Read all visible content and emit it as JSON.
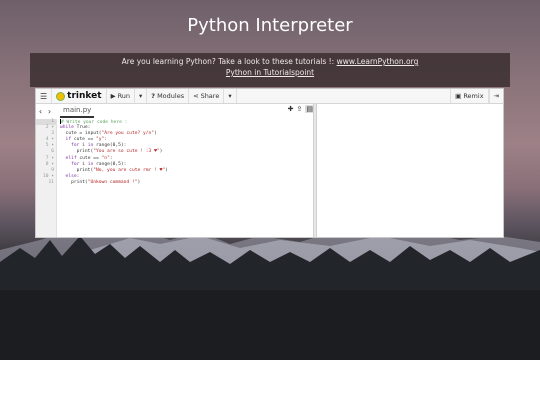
{
  "page": {
    "title": "Python Interpreter"
  },
  "banner": {
    "text": "Are you learning Python? Take a look to these tutorials !:",
    "link1": "www.LearnPython.org",
    "link2": "Python in Tutorialspoint"
  },
  "toolbar": {
    "menu_icon": "hamburger-icon",
    "logo_text": "trinket",
    "run_label": "Run",
    "modules_label": "Modules",
    "share_label": "Share",
    "remix_label": "Remix"
  },
  "editor": {
    "tab_label": "main.py",
    "line_numbers": [
      "1",
      "2 ▾",
      "3",
      "4 ▾",
      "5 ▾",
      "6",
      "7 ▾",
      "8 ▾",
      "9",
      "10 ▾",
      "11"
    ],
    "lines": [
      {
        "indent": "",
        "parts": [
          {
            "t": "# Write your code here :",
            "c": "cm"
          }
        ]
      },
      {
        "indent": "",
        "parts": [
          {
            "t": "while ",
            "c": "kw"
          },
          {
            "t": "True:",
            "c": ""
          }
        ]
      },
      {
        "indent": "  ",
        "parts": [
          {
            "t": "cute = input(",
            "c": ""
          },
          {
            "t": "\"Are you cute? y/n\"",
            "c": "st"
          },
          {
            "t": ")",
            "c": ""
          }
        ]
      },
      {
        "indent": "  ",
        "parts": [
          {
            "t": "if ",
            "c": "kw"
          },
          {
            "t": "cute == ",
            "c": ""
          },
          {
            "t": "\"y\"",
            "c": "st"
          },
          {
            "t": ":",
            "c": ""
          }
        ]
      },
      {
        "indent": "    ",
        "parts": [
          {
            "t": "for ",
            "c": "kw"
          },
          {
            "t": "i ",
            "c": ""
          },
          {
            "t": "in ",
            "c": "kw"
          },
          {
            "t": "range(0,5):",
            "c": ""
          }
        ]
      },
      {
        "indent": "      ",
        "parts": [
          {
            "t": "print(",
            "c": ""
          },
          {
            "t": "\"You are so cute ! :3 ♥\"",
            "c": "st"
          },
          {
            "t": ")",
            "c": ""
          }
        ]
      },
      {
        "indent": "  ",
        "parts": [
          {
            "t": "elif ",
            "c": "kw"
          },
          {
            "t": "cute == ",
            "c": ""
          },
          {
            "t": "\"n\"",
            "c": "st"
          },
          {
            "t": ":",
            "c": ""
          }
        ]
      },
      {
        "indent": "    ",
        "parts": [
          {
            "t": "for ",
            "c": "kw"
          },
          {
            "t": "i ",
            "c": ""
          },
          {
            "t": "in ",
            "c": "kw"
          },
          {
            "t": "range(0,5):",
            "c": ""
          }
        ]
      },
      {
        "indent": "      ",
        "parts": [
          {
            "t": "print(",
            "c": ""
          },
          {
            "t": "\"No, you are cute rmr ! ♥\"",
            "c": "st"
          },
          {
            "t": ")",
            "c": ""
          }
        ]
      },
      {
        "indent": "  ",
        "parts": [
          {
            "t": "else",
            "c": "kw"
          },
          {
            "t": ":",
            "c": ""
          }
        ]
      },
      {
        "indent": "    ",
        "parts": [
          {
            "t": "print(",
            "c": ""
          },
          {
            "t": "\"Unkown command !\"",
            "c": "st"
          },
          {
            "t": ")",
            "c": ""
          }
        ]
      }
    ]
  },
  "colors": {
    "logo_yellow": "#f0c000",
    "keyword": "#7a2da0",
    "string": "#b22222",
    "comment": "#5aa05a"
  }
}
